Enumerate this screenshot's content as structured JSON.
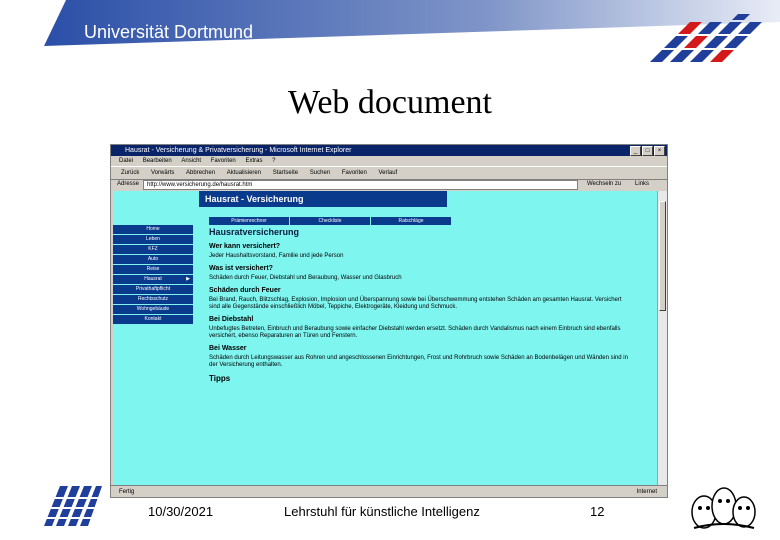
{
  "slide": {
    "header_title": "Universität Dortmund",
    "title": "Web document",
    "footer": {
      "date": "10/30/2021",
      "chair": "Lehrstuhl für künstliche Intelligenz",
      "page": "12"
    }
  },
  "browser": {
    "window_title": "Hausrat - Versicherung & Privatversicherung - Microsoft Internet Explorer",
    "menu": [
      "Datei",
      "Bearbeiten",
      "Ansicht",
      "Favoriten",
      "Extras",
      "?"
    ],
    "toolbar": [
      "Zurück",
      "Vorwärts",
      "Abbrechen",
      "Aktualisieren",
      "Startseite",
      "Suchen",
      "Favoriten",
      "Verlauf"
    ],
    "address_label": "Adresse",
    "address_value": "http://www.versicherung.de/hausrat.htm",
    "go_label": "Wechseln zu",
    "links_label": "Links",
    "status": "Fertig",
    "zone": "Internet"
  },
  "webpage": {
    "banner": "Hausrat - Versicherung",
    "tabs": [
      "Prämienrechner",
      "Checkliste",
      "Ratschläge"
    ],
    "nav": [
      "Home",
      "Leben",
      "KFZ",
      "Auto",
      "Reise",
      "Hausrat",
      "Privathaftpflicht",
      "Rechtsschutz",
      "Wohngebäude",
      "Kontakt"
    ],
    "active_nav": "Hausrat",
    "heading": "Hausratversicherung",
    "q1": "Wer kann versichert?",
    "a1": "Jeder Haushaltsvorstand, Familie und jede Person",
    "q2": "Was ist versichert?",
    "a2": "Schäden durch Feuer, Diebstahl und Beraubung, Wasser und Glasbruch",
    "s1": "Schäden durch Feuer",
    "p1": "Bei Brand, Rauch, Blitzschlag, Explosion, Implosion und Überspannung sowie bei Überschwemmung entstehen Schäden am gesamten Hausrat. Versichert sind alle Gegenstände einschließlich Möbel, Teppiche, Elektrogeräte, Kleidung und Schmuck.",
    "s2": "Bei Diebstahl",
    "p2": "Unbefugtes Betreten, Einbruch und Beraubung sowie einfacher Diebstahl werden ersetzt. Schäden durch Vandalismus nach einem Einbruch sind ebenfalls versichert, ebenso Reparaturen an Türen und Fenstern.",
    "s3": "Bei Wasser",
    "p3": "Schäden durch Leitungswasser aus Rohren und angeschlossenen Einrichtungen, Frost und Rohrbruch sowie Schäden an Bodenbelägen und Wänden sind in der Versicherung enthalten.",
    "tipps": "Tipps"
  }
}
